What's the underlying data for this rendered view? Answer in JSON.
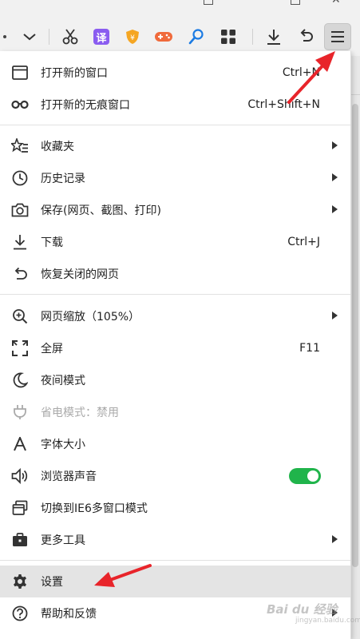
{
  "toolbar": {
    "ime_label": "译"
  },
  "menu": {
    "items": [
      {
        "label": "打开新的窗口",
        "shortcut": "Ctrl+N",
        "icon": "window-icon"
      },
      {
        "label": "打开新的无痕窗口",
        "shortcut": "Ctrl+Shift+N",
        "icon": "incognito-icon"
      },
      {
        "label": "收藏夹",
        "icon": "star-list-icon",
        "submenu": true
      },
      {
        "label": "历史记录",
        "icon": "clock-icon",
        "submenu": true
      },
      {
        "label": "保存(网页、截图、打印)",
        "icon": "camera-icon",
        "submenu": true
      },
      {
        "label": "下载",
        "shortcut": "Ctrl+J",
        "icon": "download-icon"
      },
      {
        "label": "恢复关闭的网页",
        "icon": "undo-icon"
      },
      {
        "label": "网页缩放（105%）",
        "icon": "zoom-icon",
        "submenu": true
      },
      {
        "label": "全屏",
        "shortcut": "F11",
        "icon": "fullscreen-icon"
      },
      {
        "label": "夜间模式",
        "icon": "moon-icon"
      },
      {
        "label": "省电模式：禁用",
        "icon": "plug-icon",
        "disabled": true
      },
      {
        "label": "字体大小",
        "icon": "font-icon"
      },
      {
        "label": "浏览器声音",
        "icon": "speaker-icon",
        "toggle_on": true
      },
      {
        "label": "切换到IE6多窗口模式",
        "icon": "windows-stack-icon"
      },
      {
        "label": "更多工具",
        "icon": "toolbox-icon",
        "submenu": true
      },
      {
        "label": "设置",
        "icon": "gear-icon",
        "highlighted": true
      },
      {
        "label": "帮助和反馈",
        "icon": "help-icon",
        "submenu": true
      }
    ]
  },
  "colors": {
    "toggle_on": "#20b44b",
    "annotation_arrow": "#e8242a",
    "highlight": "#e4e4e4"
  },
  "watermark": {
    "text": "Bai du 经验",
    "sub": "jingyan.baidu.com"
  }
}
